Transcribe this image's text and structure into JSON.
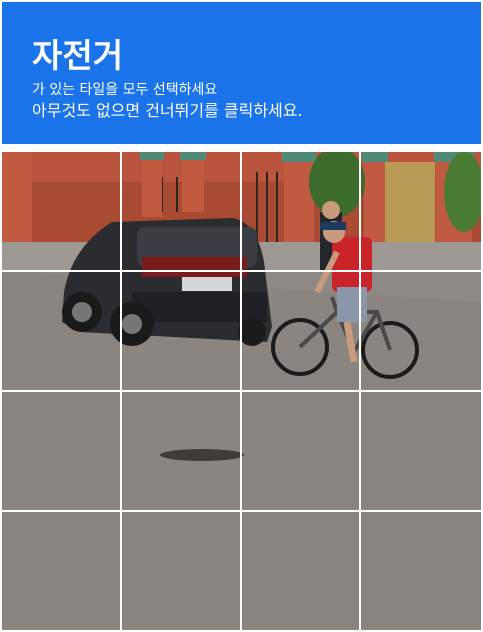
{
  "captcha": {
    "target_object": "자전거",
    "instruction_line1": "가 있는 타일을 모두 선택하세요",
    "instruction_line2": "아무것도 없으면 건너뛰기를 클릭하세요.",
    "header_color": "#1a73e8",
    "grid_rows": 4,
    "grid_cols": 4,
    "tiles": [
      {
        "row": 1,
        "col": 1
      },
      {
        "row": 1,
        "col": 2
      },
      {
        "row": 1,
        "col": 3
      },
      {
        "row": 1,
        "col": 4
      },
      {
        "row": 2,
        "col": 1
      },
      {
        "row": 2,
        "col": 2
      },
      {
        "row": 2,
        "col": 3
      },
      {
        "row": 2,
        "col": 4
      },
      {
        "row": 3,
        "col": 1
      },
      {
        "row": 3,
        "col": 2
      },
      {
        "row": 3,
        "col": 3
      },
      {
        "row": 3,
        "col": 4
      },
      {
        "row": 4,
        "col": 1
      },
      {
        "row": 4,
        "col": 2
      },
      {
        "row": 4,
        "col": 3
      },
      {
        "row": 4,
        "col": 4
      }
    ]
  }
}
